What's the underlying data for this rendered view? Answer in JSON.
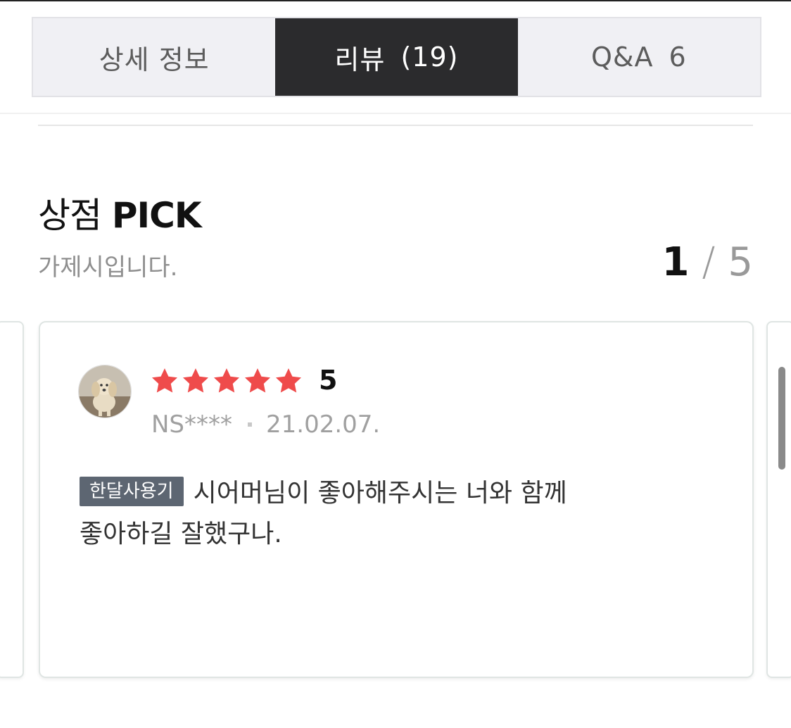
{
  "tabs": [
    {
      "label": "상세 정보",
      "count": ""
    },
    {
      "label": "리뷰",
      "count": "(19)"
    },
    {
      "label": "Q&A",
      "count": "6"
    }
  ],
  "pick": {
    "title_kr": "상점",
    "title_en": "PICK",
    "subtitle": "가제시입니다.",
    "page_current": "1",
    "page_sep": "/",
    "page_total": "5"
  },
  "review_card": {
    "rating": 5,
    "score_text": "5",
    "reviewer": "NS****",
    "date": "21.02.07.",
    "badge": "한달사용기",
    "text_line1": "시어머님이 좋아해주시는 너와 함께",
    "text_line2": "좋아하길 잘했구나.",
    "star_color": "#ef4b4b",
    "badge_color": "#5d6672"
  },
  "icons": {
    "star": "star-icon",
    "avatar": "dog-photo-avatar"
  },
  "colors": {
    "active_tab_bg": "#2b2b2d",
    "tab_bg": "#f0f0f4"
  }
}
